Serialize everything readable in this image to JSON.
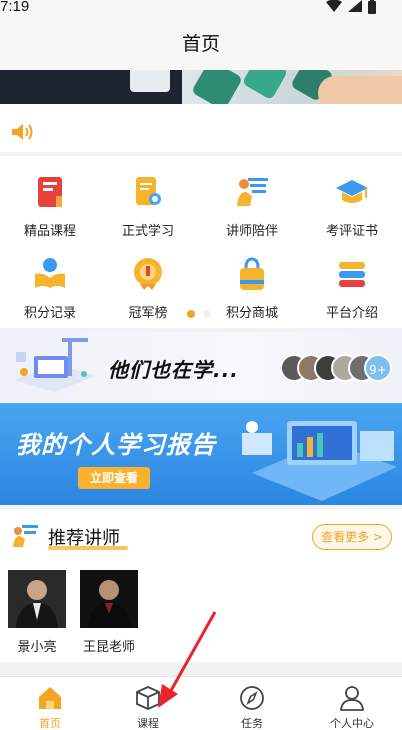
{
  "status": {
    "time": "7:19"
  },
  "header": {
    "title": "首页"
  },
  "menu": {
    "items": [
      {
        "label": "精品课程",
        "icon": "book-icon"
      },
      {
        "label": "正式学习",
        "icon": "document-search-icon"
      },
      {
        "label": "讲师陪伴",
        "icon": "teacher-board-icon"
      },
      {
        "label": "考评证书",
        "icon": "graduation-cap-icon"
      },
      {
        "label": "积分记录",
        "icon": "reading-person-icon"
      },
      {
        "label": "冠军榜",
        "icon": "medal-icon"
      },
      {
        "label": "积分商城",
        "icon": "shopping-bag-icon"
      },
      {
        "label": "平台介绍",
        "icon": "stack-icon"
      }
    ],
    "page_count": 2,
    "active_page": 0
  },
  "learners_banner": {
    "text": "他们也在学...",
    "more_count": "9+"
  },
  "report_banner": {
    "title": "我的个人学习报告",
    "button": "立即查看"
  },
  "teachers": {
    "title": "推荐讲师",
    "more": "查看更多 >",
    "list": [
      {
        "name": "景小亮"
      },
      {
        "name": "王昆老师"
      }
    ]
  },
  "nav": {
    "items": [
      {
        "label": "首页",
        "icon": "home-icon",
        "active": true
      },
      {
        "label": "课程",
        "icon": "cube-icon",
        "active": false
      },
      {
        "label": "任务",
        "icon": "compass-icon",
        "active": false
      },
      {
        "label": "个人中心",
        "icon": "person-icon",
        "active": false
      }
    ]
  },
  "colors": {
    "accent": "#f2a423",
    "banner_blue": "#2b86e3",
    "annotation_red": "#e8232a"
  }
}
